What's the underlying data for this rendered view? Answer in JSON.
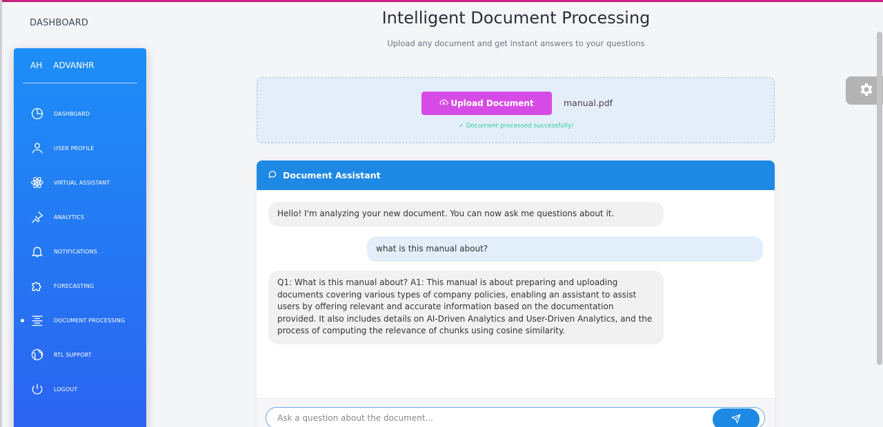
{
  "brand": "DASHBOARD",
  "sidebar": {
    "user_initials": "AH",
    "user_name": "ADVANHR",
    "items": [
      {
        "label": "DASHBOARD",
        "icon": "pie-chart-icon"
      },
      {
        "label": "USER PROFILE",
        "icon": "user-icon"
      },
      {
        "label": "VIRTUAL ASSISTANT",
        "icon": "atom-icon"
      },
      {
        "label": "ANALYTICS",
        "icon": "pin-icon"
      },
      {
        "label": "NOTIFICATIONS",
        "icon": "bell-icon"
      },
      {
        "label": "FORECASTING",
        "icon": "puzzle-icon"
      },
      {
        "label": "DOCUMENT PROCESSING",
        "icon": "align-center-icon",
        "active": true
      },
      {
        "label": "RTL SUPPORT",
        "icon": "globe-icon"
      },
      {
        "label": "LOGOUT",
        "icon": "power-icon"
      }
    ]
  },
  "header": {
    "title": "Intelligent Document Processing",
    "subtitle": "Upload any document and get instant answers to your questions"
  },
  "upload": {
    "button_label": "Upload Document",
    "filename": "manual.pdf",
    "status": "✓ Document processed successfully!"
  },
  "chat": {
    "title": "Document Assistant",
    "messages": [
      {
        "role": "bot",
        "text": "Hello! I'm analyzing your new document. You can now ask me questions about it."
      },
      {
        "role": "user",
        "text": "what is this manual about?"
      },
      {
        "role": "bot",
        "text": "Q1: What is this manual about? A1: This manual is about preparing and uploading documents covering various types of company policies, enabling an assistant to assist users by offering relevant and accurate information based on the documentation provided. It also includes details on AI-Driven Analytics and User-Driven Analytics, and the process of computing the relevance of chunks using cosine similarity."
      }
    ],
    "input_placeholder": "Ask a question about the document..."
  },
  "colors": {
    "sidebar_top": "#1e8ef7",
    "sidebar_bottom": "#2c63f0",
    "upload_button": "#d64be6",
    "chat_header": "#1e88e5",
    "status": "#2ecc9a"
  }
}
